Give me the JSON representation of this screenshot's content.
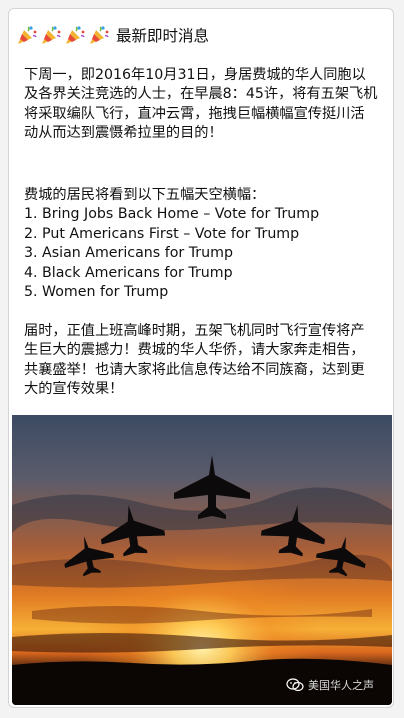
{
  "header": {
    "title": "最新即时消息",
    "icon": "party-popper-icon"
  },
  "paragraph1": "下周一，即2016年10月31日，身居费城的华人同胞以及各界关注竞选的人士，在早晨8：45许，将有五架飞机将采取编队飞行，直冲云霄，拖拽巨幅横幅宣传挺川活动从而达到震慑希拉里的目的！",
  "banners": {
    "intro": "费城的居民将看到以下五幅天空横幅：",
    "items": [
      "1. Bring Jobs Back Home – Vote for Trump",
      "2. Put Americans First – Vote for Trump",
      "3. Asian Americans for Trump",
      "4. Black Americans for Trump",
      "5. Women for Trump"
    ]
  },
  "paragraph3": "届时，正值上班高峰时期，五架飞机同时飞行宣传将产生巨大的震撼力！费城的华人华侨，请大家奔走相告，共襄盛举！也请大家将此信息传达给不同族裔，达到更大的宣传效果！",
  "photo": {
    "watermark": "美国华人之声",
    "watermark_icon": "wechat-icon"
  }
}
